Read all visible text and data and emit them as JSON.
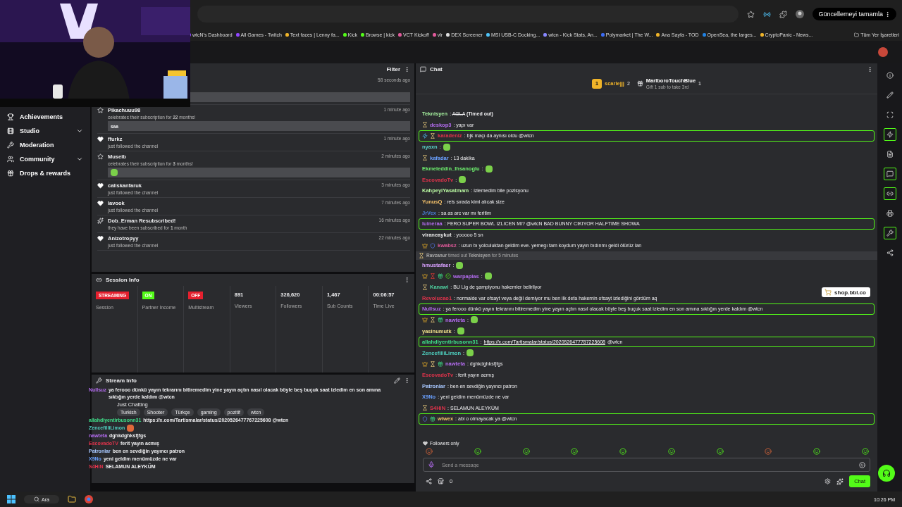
{
  "browser": {
    "update_button": "Güncellemeyi tamamla",
    "bookmarks": [
      "wtcN's Dashboard",
      "All Games - Twitch",
      "Text faces | Lenny fa...",
      "Kick",
      "Browse | kick",
      "VCT Kickoff",
      "vlr",
      "DEX Screener",
      "MSI USB-C Docking...",
      "wtcn - Kick Stats, An...",
      "Polymarket | The W...",
      "Ana Sayfa - TOD",
      "OpenSea, the larges...",
      "CryptoPanic - News..."
    ],
    "all_bookmarks": "Tüm Yer İşaretleri"
  },
  "sidebar": {
    "items": [
      {
        "label": "Achievements",
        "expandable": false
      },
      {
        "label": "Studio",
        "expandable": true
      },
      {
        "label": "Moderation",
        "expandable": false
      },
      {
        "label": "Community",
        "expandable": true
      },
      {
        "label": "Drops & rewards",
        "expandable": false
      }
    ]
  },
  "activity": {
    "filter": "Filter",
    "items": [
      {
        "kind": "hidden",
        "time": "58 seconds ago"
      },
      {
        "kind": "resub",
        "user": "Pikachuuu98",
        "text": "celebrates their subscription for **22** months!",
        "time": "1 minute ago",
        "message": "saa"
      },
      {
        "kind": "follow",
        "user": "ffurkz",
        "text": "just followed the channel",
        "time": "1 minute ago"
      },
      {
        "kind": "resub",
        "user": "Museib",
        "text": "celebrates their subscription for **3** months!",
        "time": "2 minutes ago",
        "emote": true
      },
      {
        "kind": "follow",
        "user": "caliskanfaruk",
        "text": "just followed the channel",
        "time": "3 minutes ago"
      },
      {
        "kind": "follow",
        "user": "lavook",
        "text": "just followed the channel",
        "time": "7 minutes ago"
      },
      {
        "kind": "sparkle",
        "user": "Dob_Erman Resubscribed!",
        "text": "they have been subscribed for **1** month",
        "time": "16 minutes ago"
      },
      {
        "kind": "follow",
        "user": "Anizotropyy",
        "text": "just followed the channel",
        "time": "22 minutes ago"
      }
    ]
  },
  "session_info": {
    "title": "Session Info",
    "stats": [
      {
        "kind": "pill",
        "value": "STREAMING",
        "label": "Session",
        "color": "#e5202e"
      },
      {
        "kind": "pill",
        "value": "ON",
        "label": "Partner Income",
        "color": "#53fc18"
      },
      {
        "kind": "pill",
        "value": "OFF",
        "label": "Multistream",
        "color": "#e5202e"
      },
      {
        "kind": "stat",
        "value": "891",
        "label": "Viewers"
      },
      {
        "kind": "stat",
        "value": "326,620",
        "label": "Followers"
      },
      {
        "kind": "stat",
        "value": "1,467",
        "label": "Sub Counts"
      },
      {
        "kind": "stat",
        "value": "00:06:57",
        "label": "Time Live"
      }
    ]
  },
  "stream_info": {
    "title": "Stream Info",
    "category": "Just Chatting",
    "tags": [
      "Turkish",
      "Shooter",
      "Türkçe",
      "gaming",
      "pozitif",
      "wtcn"
    ]
  },
  "overlay_chat": [
    {
      "user": "Nullsuz",
      "color": "#b46cf0",
      "text": "ya ferooo dünkü yayın tekrarını bitiremedim yine yayın açtın nasıl olacak böyle beş buçuk saat izledim en son amına sıktığın yerde kaldım @wtcn"
    },
    {
      "user": "allahdiyentirbusonn31",
      "color": "#3ee08a",
      "text": "https://x.com/Tartismalar/status/2020526477767225608 @wtcn"
    },
    {
      "user": "ZencefilliLimon",
      "color": "#4fd1c0",
      "emote": true
    },
    {
      "user": "nawteta",
      "color": "#b46cf0",
      "text": "dghkdghksfjfgs"
    },
    {
      "user": "EscovadoTV",
      "color": "#e0334b",
      "text": "ferit yayın acmış"
    },
    {
      "user": "Patronlar",
      "color": "#a8c8ff",
      "text": "ben en sevdiğin yayıncı patron"
    },
    {
      "user": "X9No",
      "color": "#6aa0ff",
      "text": "yeni geldim menümüzde ne var"
    },
    {
      "user": "S4HiN",
      "color": "#e0334b",
      "text": "SELAMUN ALEYKÜM"
    }
  ],
  "chat": {
    "title": "Chat",
    "leaderboard": [
      {
        "rank": "1",
        "user": "scarlejjj",
        "count": "2"
      },
      {
        "user": "MarlboroTouchBlue",
        "count": "1",
        "hint": "Gift 1 sub to take 3rd"
      }
    ],
    "messages": [
      {
        "kind": "timedout",
        "user": "Teknisyen",
        "color": "#a7f3a0",
        "sep": ":",
        "text": "AGLA",
        "note": "(Timed out)",
        "highlighted": false
      },
      {
        "kind": "text",
        "user": "deskop3",
        "color": "#b46cf0",
        "badges": [
          {
            "kind": "hourglass"
          }
        ],
        "sep": ":",
        "text": "yapı var",
        "highlighted": false
      },
      {
        "kind": "text",
        "user": "karadeniz",
        "color": "#e0334b",
        "badges": [
          {
            "kind": "prime"
          },
          {
            "kind": "hourglass"
          }
        ],
        "sep": ":",
        "text": "bjk maçı da aynısı oldu @wtcn",
        "highlighted": true
      },
      {
        "kind": "emote",
        "user": "nyaxn",
        "color": "#5ad0c8",
        "sep": ":",
        "highlighted": false
      },
      {
        "kind": "text",
        "user": "kafadar",
        "color": "#6aa0ff",
        "badges": [
          {
            "kind": "hourglass"
          }
        ],
        "sep": ":",
        "text": "13 dakika",
        "highlighted": false
      },
      {
        "kind": "emote",
        "user": "Ekmeleddin_Ihsanoglu",
        "color": "#6ef06e",
        "sep": ":",
        "highlighted": false
      },
      {
        "kind": "emote",
        "user": "EscovadoTv",
        "color": "#e0334b",
        "sep": ":",
        "highlighted": false
      },
      {
        "kind": "text",
        "user": "KahpeyiYasatmam",
        "color": "#b7f5a0",
        "sep": ":",
        "text": "izlemedim bile pozisyonu",
        "highlighted": false
      },
      {
        "kind": "text",
        "user": "YunusQ",
        "color": "#f5c26b",
        "sep": ":",
        "text": "reis sırada kimi alıcak size",
        "highlighted": false
      },
      {
        "kind": "text",
        "user": "JrVex",
        "color": "#4a7fd8",
        "sep": ":",
        "text": "sa as arc var mı feritim",
        "highlighted": false
      },
      {
        "kind": "text",
        "user": "luineraa",
        "color": "#b46cf0",
        "sep": ":",
        "text": "FERO SUPER BOWL IZLICEN MI? @wtcN BAD BUNNY CIKIYOR HALFTIME SHOWA",
        "highlighted": true
      },
      {
        "kind": "text",
        "user": "viraneaykut",
        "color": "#e8e8e8",
        "sep": ":",
        "text": "yooooo 5 sn",
        "highlighted": false
      },
      {
        "kind": "text",
        "user": "kwabsz",
        "color": "#e05a9a",
        "badges": [
          {
            "kind": "crown"
          },
          {
            "kind": "moderator"
          }
        ],
        "sep": ":",
        "text": "uzun bı yolculuktan geldim eve. yemegı tam koydum yayın bıdınmı geldi ölürüz lan",
        "highlighted": false
      },
      {
        "kind": "system",
        "user": "Ravzanur",
        "text": "timed out",
        "target": "Teknisyen",
        "suffix": "for 5 minutes"
      },
      {
        "kind": "emote",
        "user": "hmustafaer",
        "color": "#d8a0ff",
        "sep": ":",
        "highlighted": false
      },
      {
        "kind": "emote",
        "user": "warpaplas",
        "color": "#b46cf0",
        "sep": ":",
        "badges": [
          {
            "kind": "crown"
          },
          {
            "kind": "vip"
          },
          {
            "kind": "gift"
          },
          {
            "kind": "verified"
          }
        ],
        "highlighted": false
      },
      {
        "kind": "text",
        "user": "Kanawi",
        "color": "#4fd1a0",
        "badges": [
          {
            "kind": "hourglass"
          }
        ],
        "sep": ":",
        "text": "BU Lig de şampiyonu hakemler belirliyor",
        "highlighted": false
      },
      {
        "kind": "text",
        "user": "Revolucao1",
        "color": "#e0334b",
        "sep": ":",
        "text": "normalde var ofsayt veya değil demiyor mu ben ilk defa hakemin ofsayt izlediğini gördüm aq",
        "highlighted": false
      },
      {
        "kind": "text",
        "user": "Nullsuz",
        "color": "#b46cf0",
        "sep": ":",
        "text": "ya ferooo dünkü yayın tekrarını bitiremedim yine yayın açtın nasıl olacak böyle beş buçuk saat izledim en son amına sıktığın yerde kaldım @wtcn",
        "highlighted": true
      },
      {
        "kind": "emote",
        "user": "nawteta",
        "color": "#b46cf0",
        "sep": ":",
        "badges": [
          {
            "kind": "crown"
          },
          {
            "kind": "hourglass"
          },
          {
            "kind": "gift"
          }
        ],
        "highlighted": false
      },
      {
        "kind": "emote",
        "user": "yasinumutk",
        "color": "#f0e08a",
        "sep": ":",
        "highlighted": false
      },
      {
        "kind": "link",
        "user": "allahdiyentirbusonn31",
        "color": "#3ee08a",
        "sep": ":",
        "text": "https://x.com/Tartismalar/status/2020526477787225608",
        "suffix": "@wtcn",
        "highlighted": true
      },
      {
        "kind": "emote",
        "user": "ZencefilliLimon",
        "color": "#4fd1c0",
        "sep": ":",
        "highlighted": false
      },
      {
        "kind": "text",
        "user": "nawteta",
        "color": "#b46cf0",
        "badges": [
          {
            "kind": "crown"
          },
          {
            "kind": "hourglass"
          },
          {
            "kind": "gift"
          }
        ],
        "sep": ":",
        "text": "dghkdghksfjfgs",
        "highlighted": false
      },
      {
        "kind": "text",
        "user": "EscovadoTv",
        "color": "#e0334b",
        "sep": ":",
        "text": "ferit yayın acmış",
        "highlighted": false
      },
      {
        "kind": "text",
        "user": "Patronlar",
        "color": "#a8c8ff",
        "sep": ":",
        "text": "ben en sevdiğin yayıncı patron",
        "highlighted": false
      },
      {
        "kind": "text",
        "user": "X9No",
        "color": "#6aa0ff",
        "sep": ":",
        "text": "yeni geldim menümüzde ne var",
        "highlighted": false
      },
      {
        "kind": "text",
        "user": "S4HiN",
        "color": "#e0334b",
        "badges": [
          {
            "kind": "hourglass"
          }
        ],
        "sep": ":",
        "text": "SELAMUN ALEYKÜM",
        "highlighted": false
      },
      {
        "kind": "text",
        "user": "wiwex",
        "color": "#f5c26b",
        "badges": [
          {
            "kind": "moderator"
          },
          {
            "kind": "gift"
          }
        ],
        "sep": ":",
        "text": "abi o olmayacak ya @wtcn",
        "highlighted": true
      }
    ],
    "mode": "Followers only",
    "input": {
      "placeholder": "Send a message"
    },
    "points": "0",
    "send_button": "Chat",
    "shop": "shop.bbl.co"
  },
  "rail": [
    {
      "highlighted": false
    },
    {
      "highlighted": false
    },
    {
      "highlighted": false
    },
    {
      "highlighted": true
    },
    {
      "highlighted": false
    },
    {
      "highlighted": true
    },
    {
      "highlighted": true
    },
    {
      "highlighted": false
    },
    {
      "highlighted": true
    },
    {
      "highlighted": false
    }
  ],
  "taskbar": {
    "search": "Ara",
    "clock": "10:26 PM"
  }
}
